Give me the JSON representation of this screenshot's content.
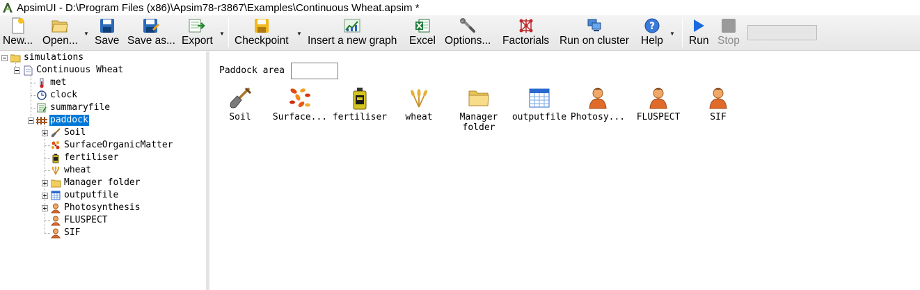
{
  "window": {
    "title": "ApsimUI - D:\\Program Files (x86)\\Apsim78-r3867\\Examples\\Continuous Wheat.apsim *",
    "app_icon": "apsim-icon"
  },
  "toolbar": {
    "new": "New...",
    "open": "Open...",
    "save": "Save",
    "save_as": "Save as...",
    "export": "Export",
    "checkpoint": "Checkpoint",
    "insert_graph": "Insert a new graph",
    "excel": "Excel",
    "options": "Options...",
    "factorials": "Factorials",
    "run_cluster": "Run on cluster",
    "help": "Help",
    "run": "Run",
    "stop": "Stop",
    "progress": 0
  },
  "tree": {
    "simulations": "simulations",
    "continuous_wheat": "Continuous Wheat",
    "met": "met",
    "clock": "clock",
    "summaryfile": "summaryfile",
    "paddock": "paddock",
    "soil": "Soil",
    "surface_om": "SurfaceOrganicMatter",
    "fertiliser": "fertiliser",
    "wheat": "wheat",
    "manager_folder": "Manager folder",
    "outputfile": "outputfile",
    "photosynthesis": "Photosynthesis",
    "fluspect": "FLUSPECT",
    "sif": "SIF"
  },
  "content": {
    "paddock_area_label": "Paddock area (ha):",
    "paddock_area_value": "",
    "children": {
      "soil": "Soil",
      "surface": "Surface...",
      "fertiliser": "fertiliser",
      "wheat": "wheat",
      "manager_line1": "Manager",
      "manager_line2": "folder",
      "outputfile": "outputfile",
      "photosy": "Photosy...",
      "fluspect": "FLUSPECT",
      "sif": "SIF"
    }
  },
  "colors": {
    "selection": "#0078d7",
    "toolbar_bg": "#ececec",
    "splitter": "#e4e4e4"
  }
}
